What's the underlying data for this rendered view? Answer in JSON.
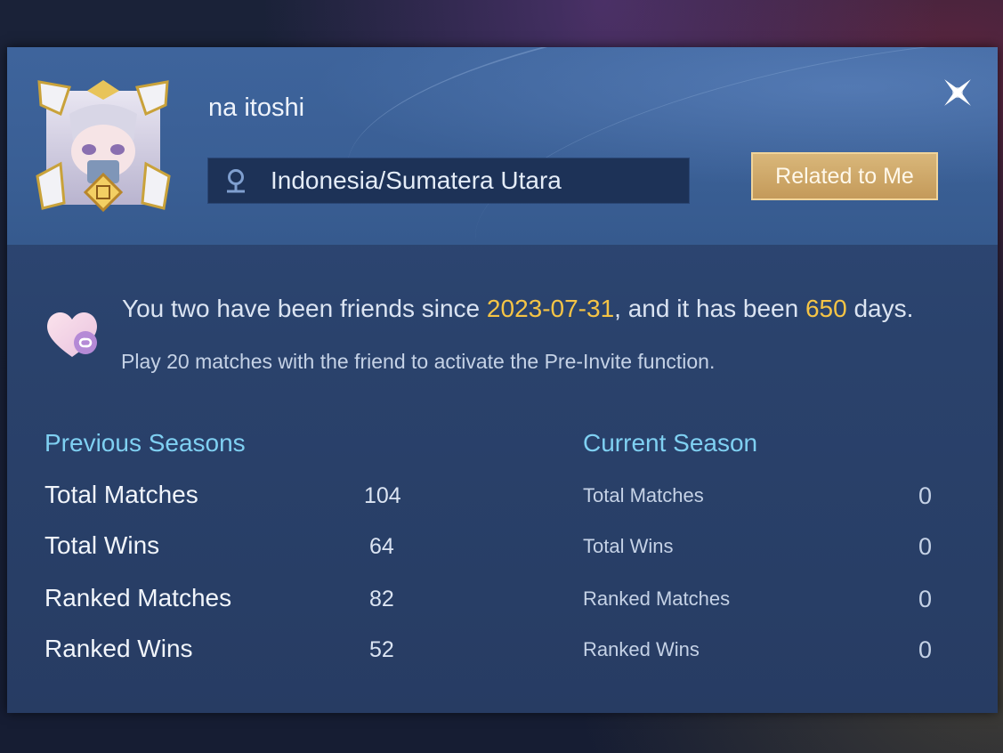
{
  "profile": {
    "username": "na itoshi",
    "location": "Indonesia/Sumatera Utara",
    "related_button": "Related to Me"
  },
  "friendship": {
    "prefix": "You two have been friends since ",
    "since_date": "2023-07-31",
    "middle": ", and it has been ",
    "days": "650",
    "suffix": " days.",
    "preinvite_note": "Play 20 matches with the friend to activate the Pre-Invite function."
  },
  "previous_seasons": {
    "title": "Previous Seasons",
    "rows": [
      {
        "label": "Total Matches",
        "value": "104"
      },
      {
        "label": "Total Wins",
        "value": "64"
      },
      {
        "label": "Ranked Matches",
        "value": "82"
      },
      {
        "label": "Ranked Wins",
        "value": "52"
      }
    ]
  },
  "current_season": {
    "title": "Current Season",
    "rows": [
      {
        "label": "Total Matches",
        "value": "0"
      },
      {
        "label": "Total Wins",
        "value": "0"
      },
      {
        "label": "Ranked Matches",
        "value": "0"
      },
      {
        "label": "Ranked Wins",
        "value": "0"
      }
    ]
  },
  "colors": {
    "highlight": "#f5c445",
    "section_title": "#7fd0f2",
    "button_gold": "#d9b77a"
  },
  "icons": {
    "close": "close-icon",
    "location": "location-pin-icon",
    "friendship": "heart-link-icon"
  }
}
